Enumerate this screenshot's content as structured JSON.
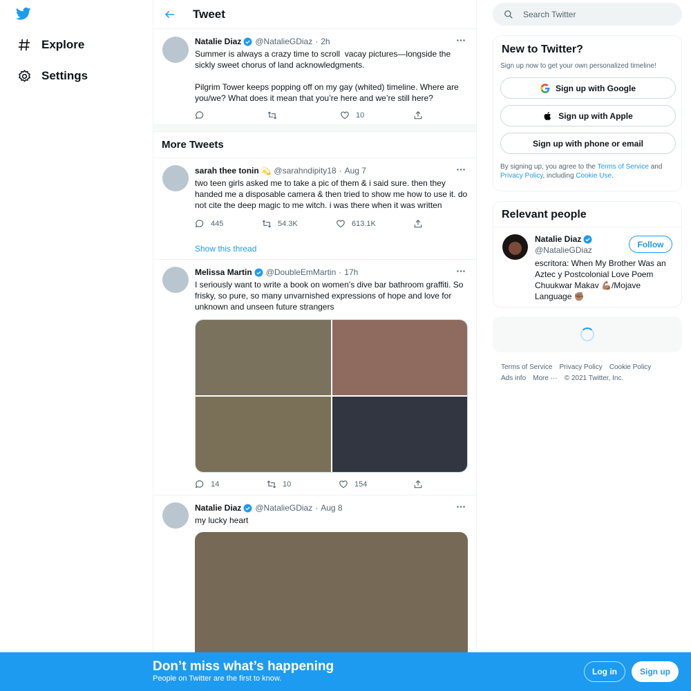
{
  "nav": {
    "logo_icon": "twitter-bird-icon",
    "items": [
      {
        "label": "Explore",
        "icon": "hashtag-icon"
      },
      {
        "label": "Settings",
        "icon": "gear-icon"
      }
    ]
  },
  "header": {
    "title": "Tweet"
  },
  "main_tweet": {
    "name": "Natalie Diaz",
    "handle": "@NatalieGDiaz",
    "time": "2h",
    "text": "Summer is always a crazy time to scroll  vacay pictures—longside the sickly sweet chorus of land acknowledgments.\n\nPilgrim Tower keeps popping off on my gay (whited) timeline. Where are you/we? What does it mean that you’re here and we’re still here?",
    "likes": "10"
  },
  "more_tweets": {
    "title": "More Tweets",
    "tweets": [
      {
        "name": "sarah thee tonin",
        "emoji": "💫",
        "handle": "@sarahndipity18",
        "time": "Aug 7",
        "text": "two teen girls asked me to take a pic of them & i said sure. then they handed me a disposable camera & then tried to show me how to use it. do not cite the deep magic to me witch. i was there when it was written",
        "replies": "445",
        "retweets": "54.3K",
        "likes": "613.1K",
        "show_thread": "Show this thread"
      },
      {
        "name": "Melissa Martin",
        "handle": "@DoubleEmMartin",
        "time": "17h",
        "text": "I seriously want to write a book on women’s dive bar bathroom graffiti. So frisky, so pure, so many unvarnished expressions of hope and love for unknown and unseen future strangers",
        "replies": "14",
        "retweets": "10",
        "likes": "154",
        "media_colors": [
          "#7a725c",
          "#8f6a5f",
          "#797057",
          "#323641"
        ]
      },
      {
        "name": "Natalie Diaz",
        "handle": "@NatalieGDiaz",
        "time": "Aug 8",
        "text": "my lucky heart",
        "media_color": "#766a56"
      }
    ]
  },
  "search": {
    "placeholder": "Search Twitter"
  },
  "new_to_twitter": {
    "title": "New to Twitter?",
    "subtitle": "Sign up now to get your own personalized timeline!",
    "google": "Sign up with Google",
    "apple": "Sign up with Apple",
    "phone": "Sign up with phone or email",
    "terms_prefix": "By signing up, you agree to the ",
    "terms_link": "Terms of Service",
    "terms_and": " and ",
    "privacy_link": "Privacy Policy",
    "terms_including": ", including ",
    "cookie_link": "Cookie Use",
    "terms_end": "."
  },
  "relevant_people": {
    "title": "Relevant people",
    "name": "Natalie Diaz",
    "handle": "@NatalieGDiaz",
    "follow": "Follow",
    "bio": "escritora: When My Brother Was an Aztec y Postcolonial Love Poem Chuukwar Makav 💪🏽/Mojave Language ✊🏽"
  },
  "footer": {
    "terms": "Terms of Service",
    "privacy": "Privacy Policy",
    "cookie": "Cookie Policy",
    "ads": "Ads info",
    "more": "More ···",
    "copyright": "© 2021 Twitter, Inc."
  },
  "bottom_bar": {
    "title": "Don’t miss what’s happening",
    "subtitle": "People on Twitter are the first to know.",
    "login": "Log in",
    "signup": "Sign up"
  },
  "colors": {
    "accent": "#1d9bf0",
    "text": "#0f1419",
    "muted": "#536471"
  }
}
